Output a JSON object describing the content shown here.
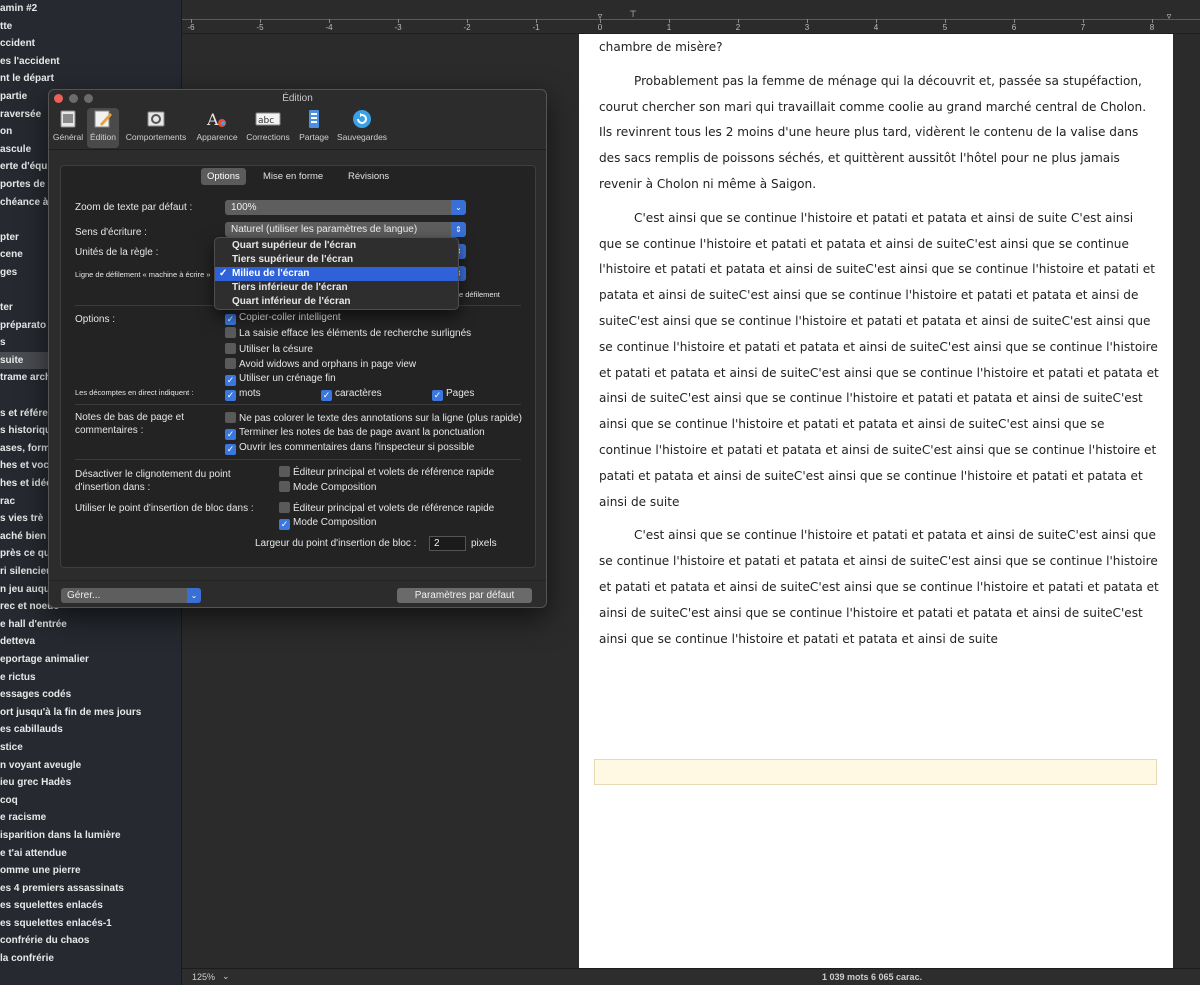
{
  "binder": {
    "items": [
      {
        "label": "amin #2"
      },
      {
        "label": "tte"
      },
      {
        "label": "ccident"
      },
      {
        "label": "es l'accident"
      },
      {
        "label": "nt le départ"
      },
      {
        "label": "partie"
      },
      {
        "label": "raversée"
      },
      {
        "label": "on"
      },
      {
        "label": "ascule"
      },
      {
        "label": "erte d'équ"
      },
      {
        "label": "portes de l"
      },
      {
        "label": "chéance à C"
      },
      {
        "label": ""
      },
      {
        "label": "pter"
      },
      {
        "label": "cene"
      },
      {
        "label": "ges"
      },
      {
        "label": ""
      },
      {
        "label": "ter"
      },
      {
        "label": " préparato"
      },
      {
        "label": "s"
      },
      {
        "label": "suite",
        "selected": true
      },
      {
        "label": "trame arch"
      },
      {
        "label": ""
      },
      {
        "label": "s et référe"
      },
      {
        "label": "s historiqu"
      },
      {
        "label": "ases, formu"
      },
      {
        "label": "hes et voca"
      },
      {
        "label": "hes et idée"
      },
      {
        "label": "rac"
      },
      {
        "label": "s vies trè"
      },
      {
        "label": "aché bien"
      },
      {
        "label": "près ce qu"
      },
      {
        "label": "ri silencieu"
      },
      {
        "label": "n jeu auqu"
      },
      {
        "label": "rec et noeuc"
      },
      {
        "label": "e hall d'entrée"
      },
      {
        "label": "detteva"
      },
      {
        "label": "eportage animalier"
      },
      {
        "label": "e rictus"
      },
      {
        "label": "essages codés"
      },
      {
        "label": "ort jusqu'à la fin de mes jours"
      },
      {
        "label": "es cabillauds"
      },
      {
        "label": "stice"
      },
      {
        "label": "n voyant aveugle"
      },
      {
        "label": "ieu grec Hadès"
      },
      {
        "label": " coq"
      },
      {
        "label": "e racisme"
      },
      {
        "label": "isparition dans la lumière"
      },
      {
        "label": "e t'ai attendue"
      },
      {
        "label": "omme une pierre"
      },
      {
        "label": "es 4 premiers assassinats"
      },
      {
        "label": "es squelettes enlacés"
      },
      {
        "label": "es squelettes enlacés-1"
      },
      {
        "label": " confrérie du chaos"
      },
      {
        "label": "   la confrérie"
      }
    ]
  },
  "ruler": {
    "labels": [
      "-6",
      "-5",
      "-4",
      "-3",
      "-2",
      "-1",
      "0",
      "1",
      "2",
      "3",
      "4",
      "5",
      "6",
      "7",
      "8"
    ]
  },
  "document": {
    "paragraphs": [
      "chambre de misère?",
      "Probablement pas la femme de ménage qui la découvrit et, passée sa stupéfaction, courut chercher son mari qui travaillait comme coolie au grand marché central de Cholon. Ils revinrent tous les 2 moins d'une heure plus tard, vidèrent le contenu de la valise dans des sacs remplis de poissons séchés, et quittèrent aussitôt l'hôtel pour ne plus jamais revenir à Cholon ni même à Saigon.",
      "C'est ainsi que se continue l'histoire et patati et patata et ainsi de suite C'est ainsi que se continue l'histoire et patati et patata et ainsi de suiteC'est ainsi que se continue l'histoire et patati et patata et ainsi de suiteC'est ainsi que se continue l'histoire et patati et patata et ainsi de suiteC'est ainsi que se continue l'histoire et patati et patata et ainsi de suiteC'est ainsi que se continue l'histoire et patati et patata et ainsi de suiteC'est ainsi que se continue l'histoire et patati et patata et ainsi de suiteC'est ainsi que se continue l'histoire et patati et patata et ainsi de suiteC'est ainsi que se continue l'histoire et patati et patata et ainsi de suiteC'est ainsi que se continue l'histoire et patati et patata et ainsi de suiteC'est ainsi que se continue l'histoire et patati et patata et ainsi de suiteC'est ainsi que se continue l'histoire et patati et patata et ainsi de suiteC'est ainsi que se continue l'histoire et patati et patata et ainsi de suiteC'est ainsi que se continue l'histoire et patati et patata et ainsi de suite",
      "C'est ainsi que se continue l'histoire et patati et patata et ainsi de suiteC'est ainsi que se continue l'histoire et patati et patata et ainsi de suiteC'est ainsi que se continue l'histoire et patati et patata et ainsi de suiteC'est ainsi que se continue l'histoire et patati et patata et ainsi de suiteC'est ainsi que se continue l'histoire et patati et patata et ainsi de suiteC'est ainsi que se continue l'histoire et patati et patata et ainsi de suite"
    ]
  },
  "statusbar": {
    "zoom": "125%",
    "counts": "1 039 mots    6 065 carac."
  },
  "prefs": {
    "title": "Édition",
    "toolbar": [
      {
        "label": "Général",
        "icon": "general-icon"
      },
      {
        "label": "Édition",
        "icon": "edit-icon",
        "active": true
      },
      {
        "label": "Comportements",
        "icon": "behaviours-icon"
      },
      {
        "label": "Apparence",
        "icon": "appearance-icon"
      },
      {
        "label": "Corrections",
        "icon": "corrections-icon"
      },
      {
        "label": "Partage",
        "icon": "sharing-icon"
      },
      {
        "label": "Sauvegardes",
        "icon": "backup-icon"
      }
    ],
    "tabs": [
      {
        "label": "Options",
        "active": true
      },
      {
        "label": "Mise en forme"
      },
      {
        "label": "Révisions"
      }
    ],
    "zoom_label": "Zoom de texte par défaut :",
    "zoom_value": "100%",
    "direction_label": "Sens d'écriture :",
    "direction_value": "Naturel (utiliser les paramètres de langue)",
    "ruler_units_label": "Unités de la règle :",
    "typewriter_label": "Ligne de défilement « machine à écrire »",
    "typewriter_suffix": "e défilement",
    "options_label": "Options :",
    "options": [
      {
        "label": "Copier-coller intelligent",
        "checked": true
      },
      {
        "label": "La saisie efface les éléments de recherche surlignés",
        "checked": false
      },
      {
        "label": "Utiliser la césure",
        "checked": false
      },
      {
        "label": "Avoid widows and orphans in page view",
        "checked": false
      },
      {
        "label": "Utiliser un crénage fin",
        "checked": true
      }
    ],
    "live_counts_label": "Les décomptes en direct indiquent :",
    "live_counts": [
      {
        "label": "mots",
        "checked": true
      },
      {
        "label": "caractères",
        "checked": true
      },
      {
        "label": "Pages",
        "checked": true
      }
    ],
    "footnotes_label": "Notes de bas de page et commentaires :",
    "footnotes": [
      {
        "label": "Ne pas colorer le texte des annotations sur la ligne (plus rapide)",
        "checked": false
      },
      {
        "label": "Terminer les notes de bas de page avant la ponctuation",
        "checked": true
      },
      {
        "label": "Ouvrir les commentaires dans l'inspecteur si possible",
        "checked": true
      }
    ],
    "blink_label": "Désactiver le clignotement du point d'insertion dans :",
    "blink": [
      {
        "label": "Éditeur principal et volets de référence rapide",
        "checked": false
      },
      {
        "label": "Mode Composition",
        "checked": false
      }
    ],
    "block_label": "Utiliser le point d'insertion de bloc dans :",
    "block": [
      {
        "label": "Éditeur principal et volets de référence rapide",
        "checked": false
      },
      {
        "label": "Mode Composition",
        "checked": true
      }
    ],
    "caret_width_label": "Largeur du point d'insertion de bloc :",
    "caret_width_value": "2",
    "caret_width_unit": "pixels",
    "manage_label": "Gérer...",
    "defaults_label": "Paramètres par défaut"
  },
  "dropdown": {
    "items": [
      {
        "label": "Quart supérieur de l'écran"
      },
      {
        "label": "Tiers supérieur de l'écran"
      },
      {
        "label": "Milieu de l'écran",
        "checked": true
      },
      {
        "label": "Tiers inférieur de l'écran"
      },
      {
        "label": "Quart inférieur de l'écran"
      }
    ]
  },
  "colors": {
    "accent": "#3a78e0",
    "menu_highlight": "#2f62d9",
    "close_button": "#ed5f57"
  }
}
